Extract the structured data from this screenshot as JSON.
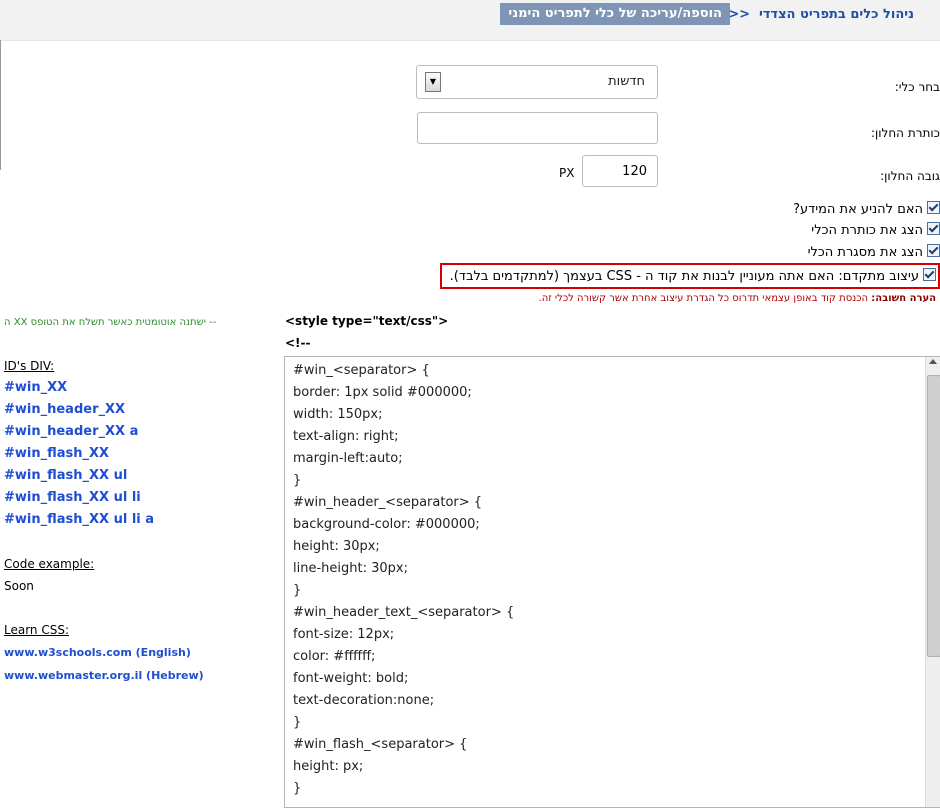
{
  "breadcrumb": {
    "home": "ניהול כלים בתפריט הצדדי",
    "separator": ">>",
    "current": "הוספה/עריכה של כלי לתפריט הימני"
  },
  "form": {
    "select_label": "בחר כלי:",
    "select_value": "חדשות",
    "window_title_label": "כותרת החלון:",
    "window_title_value": "",
    "window_height_label": "גובה החלון:",
    "window_height_value": "120",
    "height_unit": "PX",
    "checkboxes": [
      {
        "label": "האם להניע את המידע?",
        "checked": true
      },
      {
        "label": "הצג את כותרת הכלי",
        "checked": true
      },
      {
        "label": "הצג את מסגרת הכלי",
        "checked": true
      },
      {
        "label": "עיצוב מתקדם: האם אתה מעוניין לבנות את קוד ה - CSS בעצמך (למתקדמים בלבד).",
        "checked": true
      }
    ],
    "note_bold": "הערה חשובה:",
    "note_text": " הכנסת קוד באופן עצמאי תדרוס כל הגדרת עיצוב אחרת אשר קשורה לכלי זה."
  },
  "sidebar": {
    "hint": "-- ישתנה אוטומטית כאשר תשלח את הטופס XX ה",
    "ids_title": "ID's DIV:",
    "ids": [
      "#win_XX",
      "#win_header_XX",
      "#win_header_XX a",
      "#win_flash_XX",
      "#win_flash_XX ul",
      "#win_flash_XX ul li",
      "#win_flash_XX ul li a"
    ],
    "code_example_title": "Code example:",
    "code_example_text": "Soon",
    "learn_title": "Learn CSS:",
    "learn_links": [
      "www.w3schools.com (English)",
      "www.webmaster.org.il (Hebrew)"
    ]
  },
  "code": {
    "open_tag": "<style type=\"text/css\">",
    "comment_open": "<!--",
    "lines": [
      "#win_<separator> {",
      "border: 1px solid #000000;",
      "width: 150px;",
      "text-align: right;",
      "margin-left:auto;",
      "}",
      "#win_header_<separator> {",
      "background-color: #000000;",
      "height: 30px;",
      "line-height: 30px;",
      "}",
      "#win_header_text_<separator> {",
      "font-size: 12px;",
      "color: #ffffff;",
      "font-weight: bold;",
      "text-decoration:none;",
      "}",
      "#win_flash_<separator> {",
      "height: px;",
      "}"
    ]
  },
  "colors": {
    "link": "#1f4fd0",
    "breadcrumb_bg": "#7f95b5",
    "advanced_border": "#d40000"
  }
}
